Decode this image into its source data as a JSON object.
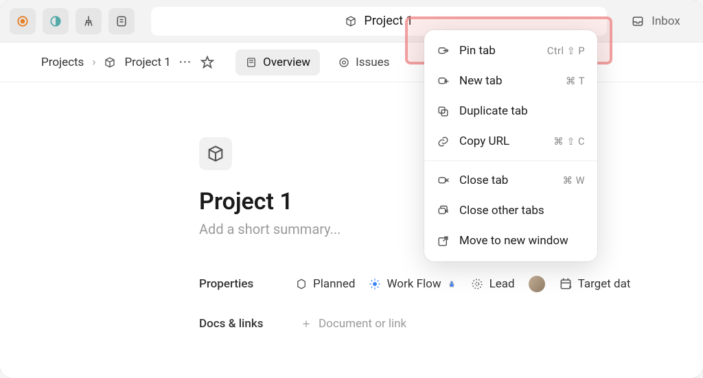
{
  "titlebar": {
    "tab_label": "Project 1",
    "inbox_label": "Inbox"
  },
  "breadcrumb": {
    "root": "Projects",
    "current": "Project 1"
  },
  "tabs": {
    "overview": "Overview",
    "issues": "Issues"
  },
  "project": {
    "title": "Project 1",
    "summary_placeholder": "Add a short summary..."
  },
  "properties": {
    "label": "Properties",
    "status": "Planned",
    "workflow": "Work Flow",
    "lead": "Lead",
    "target_date": "Target dat"
  },
  "docs": {
    "label": "Docs & links",
    "add": "Document or link"
  },
  "context_menu": {
    "pin": {
      "label": "Pin tab",
      "shortcut": "Ctrl ⇧ P"
    },
    "new": {
      "label": "New tab",
      "shortcut": "⌘ T"
    },
    "duplicate": {
      "label": "Duplicate tab",
      "shortcut": ""
    },
    "copy_url": {
      "label": "Copy URL",
      "shortcut": "⌘ ⇧ C"
    },
    "close": {
      "label": "Close tab",
      "shortcut": "⌘ W"
    },
    "close_others": {
      "label": "Close other tabs",
      "shortcut": ""
    },
    "move_window": {
      "label": "Move to new window",
      "shortcut": ""
    }
  }
}
